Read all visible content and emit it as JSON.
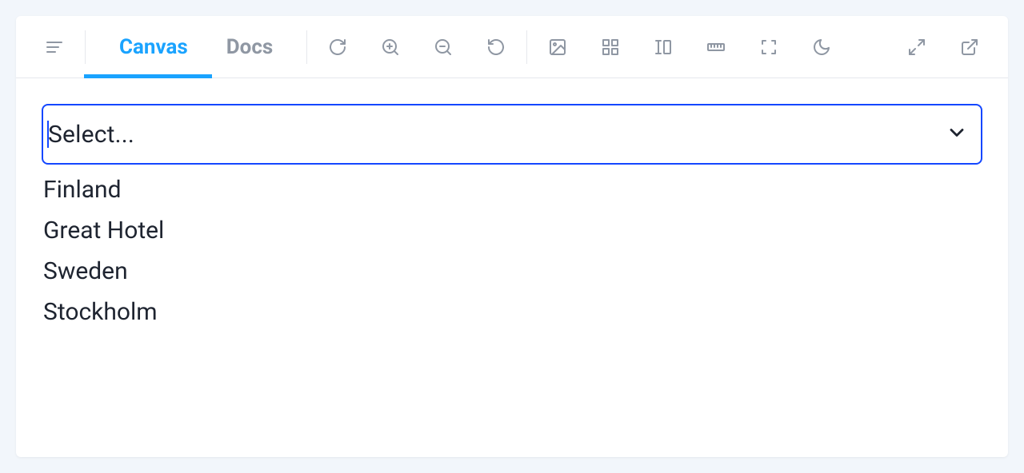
{
  "toolbar": {
    "tabs": [
      {
        "label": "Canvas",
        "active": true
      },
      {
        "label": "Docs",
        "active": false
      }
    ]
  },
  "select": {
    "placeholder": "Select...",
    "options": [
      "Finland",
      "Great Hotel",
      "Sweden",
      "Stockholm"
    ]
  }
}
